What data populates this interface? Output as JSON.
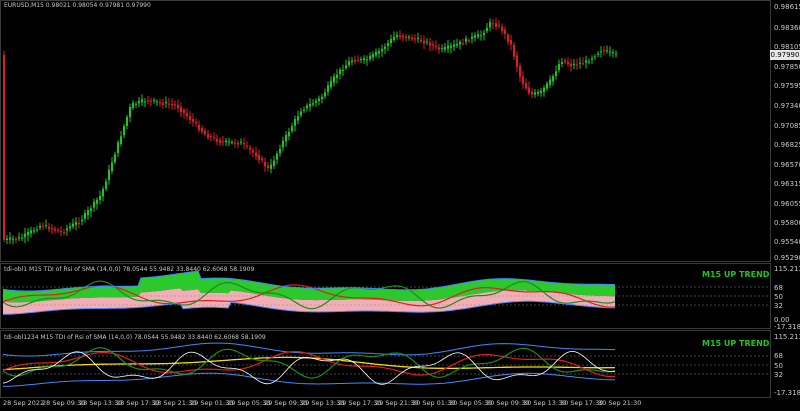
{
  "main_chart": {
    "header": "EURUSD,M15  0.98021 0.98054 0.97981 0.97990",
    "current_price": "0.97990",
    "y_labels": [
      "0.98615",
      "0.98360",
      "0.98105",
      "0.97850",
      "0.97595",
      "0.97340",
      "0.97085",
      "0.96825",
      "0.96570",
      "0.96315",
      "0.96055",
      "0.95800",
      "0.95540",
      "0.95290"
    ],
    "colors": {
      "bull": "#19c819",
      "bear": "#e01e1e",
      "background": "#000000"
    }
  },
  "indicator1": {
    "header": "tdi-obl1 M15 TDI of Rsi of SMA (14,0,0) 78.0544 55.9482 33.8440 62.6068 58.1909",
    "trend_label": "M15 UP TREND",
    "y_labels": [
      "115.2134",
      "68",
      "50",
      "32",
      "0.00"
    ],
    "scale_bottom": "-17.3188"
  },
  "indicator2": {
    "header": "tdi-obl1234 M15 TDI of Rsi of SMA (14,0,0) 78.0544 55.9482 33.8440 62.6068 58.1909",
    "trend_label": "M15 UP TREND",
    "y_labels": [
      "115.2134",
      "68",
      "50",
      "32",
      "-17.3188"
    ]
  },
  "x_axis": [
    "28 Sep 2022",
    "28 Sep 09:30",
    "28 Sep 13:30",
    "28 Sep 17:30",
    "28 Sep 21:30",
    "29 Sep 01:30",
    "29 Sep 05:30",
    "29 Sep 09:30",
    "29 Sep 13:30",
    "29 Sep 17:30",
    "29 Sep 21:30",
    "30 Sep 01:30",
    "30 Sep 05:30",
    "30 Sep 09:30",
    "30 Sep 13:30",
    "30 Sep 17:30",
    "30 Sep 21:30"
  ]
}
